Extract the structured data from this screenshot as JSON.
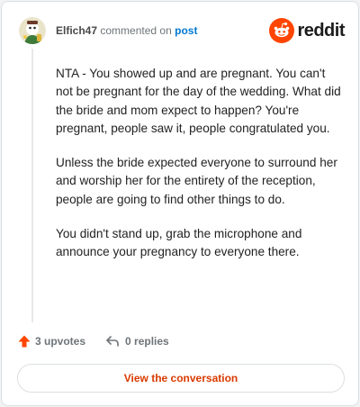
{
  "header": {
    "username": "Elfich47",
    "action": "commented on",
    "post_link": "post"
  },
  "brand": {
    "name": "reddit",
    "icon": "reddit-snoo-icon",
    "accent": "#ff4500"
  },
  "comment": {
    "paragraphs": [
      "NTA - You showed up and are pregnant. You can't not be pregnant for the day of the wedding. What did the bride and mom expect to happen? You're pregnant, people saw it, people congratulated you.",
      "Unless the bride expected everyone to surround her and worship her for the entirety of the reception, people are going to find other things to do.",
      "You didn't stand up, grab the microphone and announce your pregnancy to everyone there."
    ]
  },
  "actions": {
    "upvotes": "3 upvotes",
    "replies": "0 replies"
  },
  "cta": {
    "label": "View the conversation",
    "color": "#d93a00"
  }
}
